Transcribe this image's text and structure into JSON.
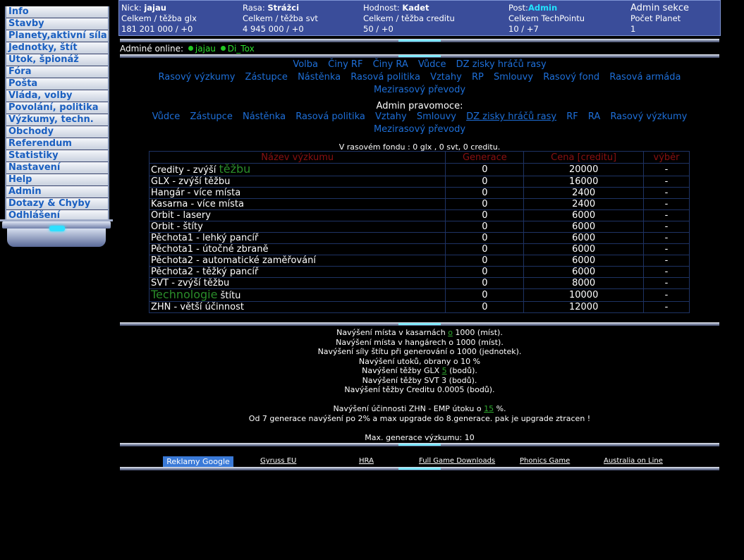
{
  "menu": [
    "Info",
    "Stavby",
    "Planety,aktivní síla",
    "Jednotky, štít",
    "Útok, špionáž",
    "Fóra",
    "Pošta",
    "Vláda, volby",
    "Povolání, politika",
    "Výzkumy, techn.",
    "Obchody",
    "Referendum",
    "Statistiky",
    "Nastavení",
    "Help",
    "Admin",
    "Dotazy & Chyby",
    "Odhlášení"
  ],
  "header": {
    "nick_label": "Nick:",
    "nick": "jajau",
    "race_label": "Rasa:",
    "race": "Strážci",
    "rank_label": "Hodnost:",
    "rank": "Kadet",
    "post_label": "Post:",
    "post": "Admin",
    "admin_section": "Admin sekce",
    "glx_label": "Celkem / těžba glx",
    "glx_value": "181 201 000 / +0",
    "svt_label": "Celkem / těžba svt",
    "svt_value": "4 945 000 / +0",
    "credit_label": "Celkem / těžba creditu",
    "credit_value": "50 / +0",
    "techpoint_label": "Celkem TechPointu",
    "techpoint_value": "10 / +7",
    "planets_label": "Počet Planet",
    "planets_value": "1"
  },
  "online": {
    "label": "Adminé online:",
    "users": [
      "jajau",
      "Di_Tox"
    ]
  },
  "race_nav": [
    "Volba",
    "Činy RF",
    "Činy RA",
    "Vůdce",
    "DZ zisky hráčů rasy",
    "Rasový výzkumy",
    "Zástupce",
    "Nástěnka",
    "Rasová politika",
    "Vztahy",
    "RP",
    "Smlouvy",
    "Rasový fond",
    "Rasová armáda",
    "Mezirasový převody"
  ],
  "admin_nav": {
    "title": "Admin pravomoce:",
    "links": [
      "Vůdce",
      "Zástupce",
      "Nástěnka",
      "Rasová politika",
      "Vztahy",
      "Smlouvy",
      "DZ zisky hráčů rasy",
      "RF",
      "RA",
      "Rasový výzkumy",
      "Mezirasový převody"
    ]
  },
  "fund": "V rasovém fondu : 0 glx , 0 svt, 0 creditu.",
  "table": {
    "headers": [
      "Název výzkumu",
      "Generace",
      "Cena [creditu]",
      "výběr"
    ],
    "rows": [
      {
        "pre": "Credity - zvýší ",
        "hl": "těžbu",
        "post": "",
        "gen": "0",
        "price": "20000",
        "sel": "-"
      },
      {
        "pre": "GLX - zvýší těžbu",
        "hl": "",
        "post": "",
        "gen": "0",
        "price": "16000",
        "sel": "-"
      },
      {
        "pre": "Hangár - více místa",
        "hl": "",
        "post": "",
        "gen": "0",
        "price": "2400",
        "sel": "-"
      },
      {
        "pre": "Kasarna - více místa",
        "hl": "",
        "post": "",
        "gen": "0",
        "price": "2400",
        "sel": "-"
      },
      {
        "pre": "Orbit - lasery",
        "hl": "",
        "post": "",
        "gen": "0",
        "price": "6000",
        "sel": "-"
      },
      {
        "pre": "Orbit - štíty",
        "hl": "",
        "post": "",
        "gen": "0",
        "price": "6000",
        "sel": "-"
      },
      {
        "pre": "Pěchota1 - lehký pancíř",
        "hl": "",
        "post": "",
        "gen": "0",
        "price": "6000",
        "sel": "-"
      },
      {
        "pre": "Pěchota1 - útočné zbraně",
        "hl": "",
        "post": "",
        "gen": "0",
        "price": "6000",
        "sel": "-"
      },
      {
        "pre": "Pěchota2 - automatické zaměřování",
        "hl": "",
        "post": "",
        "gen": "0",
        "price": "6000",
        "sel": "-"
      },
      {
        "pre": "Pěchota2 - těžký pancíř",
        "hl": "",
        "post": "",
        "gen": "0",
        "price": "6000",
        "sel": "-"
      },
      {
        "pre": "SVT - zvýší těžbu",
        "hl": "",
        "post": "",
        "gen": "0",
        "price": "8000",
        "sel": "-"
      },
      {
        "pre": "",
        "hl": "Technologie",
        "post": " štítu",
        "gen": "0",
        "price": "10000",
        "sel": "-"
      },
      {
        "pre": "ZHN - větší účinnost",
        "hl": "",
        "post": "",
        "gen": "0",
        "price": "12000",
        "sel": "-"
      }
    ]
  },
  "notes": [
    {
      "pre": "Navýšení místa v kasarnách ",
      "hl": "o",
      "post": " 1000 (míst)."
    },
    {
      "pre": "Navýšení místa v hangárech o 1000 (míst).",
      "hl": "",
      "post": ""
    },
    {
      "pre": "Navýšení síly štítu při generování o 1000 (jednotek).",
      "hl": "",
      "post": ""
    },
    {
      "pre": "Navýšení utoků, obrany o 10 %",
      "hl": "",
      "post": ""
    },
    {
      "pre": "Navýšení těžby GLX ",
      "hl": "5",
      "post": " (bodů)."
    },
    {
      "pre": "Navýšení těžby SVT 3 (bodů).",
      "hl": "",
      "post": ""
    },
    {
      "pre": "Navýšení těžby Creditu 0.0005 (bodů).",
      "hl": "",
      "post": ""
    },
    {
      "pre": "",
      "hl": "",
      "post": ""
    },
    {
      "pre": "Navýšení účinnosti ZHN - EMP útoku o ",
      "hl": "15",
      "post": " %."
    },
    {
      "pre": "Od 7 generace navýšení po 2% a max upgrade do 8.generace. pak je upgrade ztracen !",
      "hl": "",
      "post": ""
    },
    {
      "pre": "",
      "hl": "",
      "post": ""
    },
    {
      "pre": "Max. generace výzkumu: 10",
      "hl": "",
      "post": ""
    }
  ],
  "ads": {
    "button": "Reklamy Google",
    "links": [
      "Gyruss EU",
      "HRA",
      "Full Game Downloads",
      "Phonics Game",
      "Australia on Line"
    ]
  },
  "colors": {
    "link_blue": "#1e6fd8",
    "header_bg": "#3a4d9a",
    "highlight_green": "#2ee02e",
    "post_cyan": "#22e4ff",
    "table_header_red": "#8a1010"
  }
}
